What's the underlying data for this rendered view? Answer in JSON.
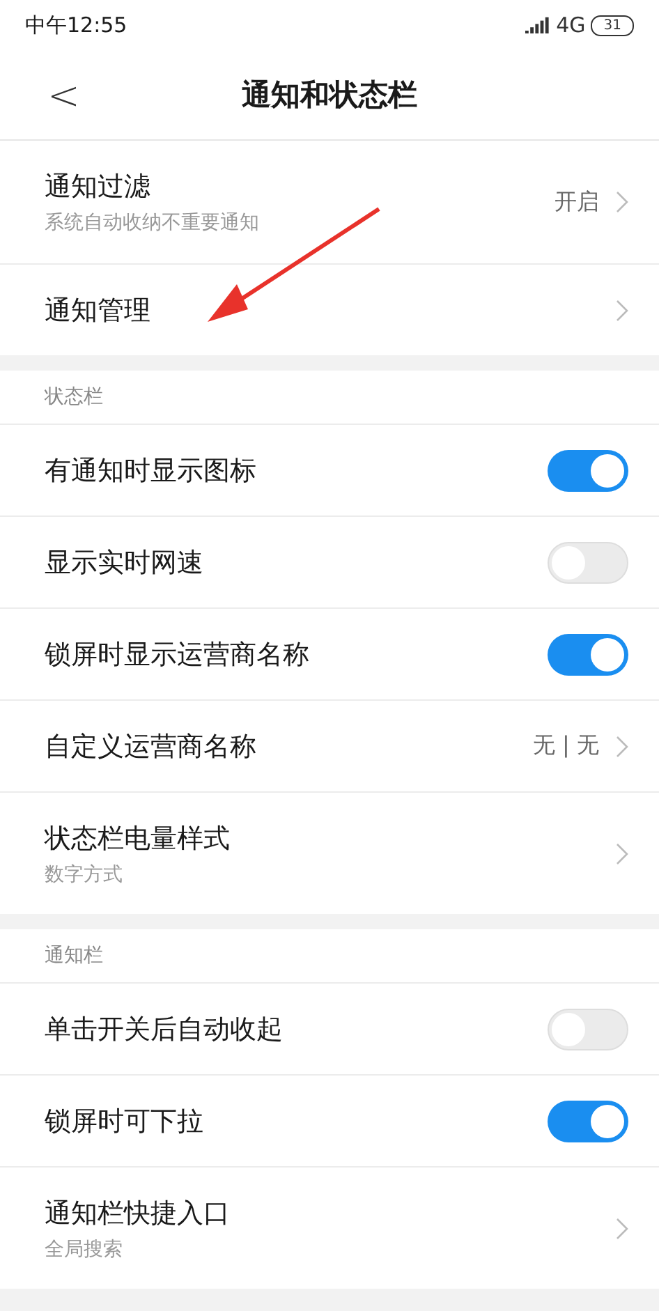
{
  "status_bar": {
    "time": "中午12:55",
    "network": "4G",
    "battery": "31"
  },
  "header": {
    "back": "<",
    "title": "通知和状态栏"
  },
  "sections": [
    {
      "items": [
        {
          "kind": "link",
          "label": "通知过滤",
          "subtitle": "系统自动收纳不重要通知",
          "value": "开启"
        },
        {
          "kind": "link",
          "label": "通知管理"
        }
      ]
    },
    {
      "title": "状态栏",
      "items": [
        {
          "kind": "toggle",
          "label": "有通知时显示图标",
          "on": true
        },
        {
          "kind": "toggle",
          "label": "显示实时网速",
          "on": false
        },
        {
          "kind": "toggle",
          "label": "锁屏时显示运营商名称",
          "on": true
        },
        {
          "kind": "link",
          "label": "自定义运营商名称",
          "value": "无 | 无"
        },
        {
          "kind": "link",
          "label": "状态栏电量样式",
          "subtitle": "数字方式"
        }
      ]
    },
    {
      "title": "通知栏",
      "items": [
        {
          "kind": "toggle",
          "label": "单击开关后自动收起",
          "on": false
        },
        {
          "kind": "toggle",
          "label": "锁屏时可下拉",
          "on": true
        },
        {
          "kind": "link",
          "label": "通知栏快捷入口",
          "subtitle": "全局搜索"
        }
      ]
    }
  ]
}
